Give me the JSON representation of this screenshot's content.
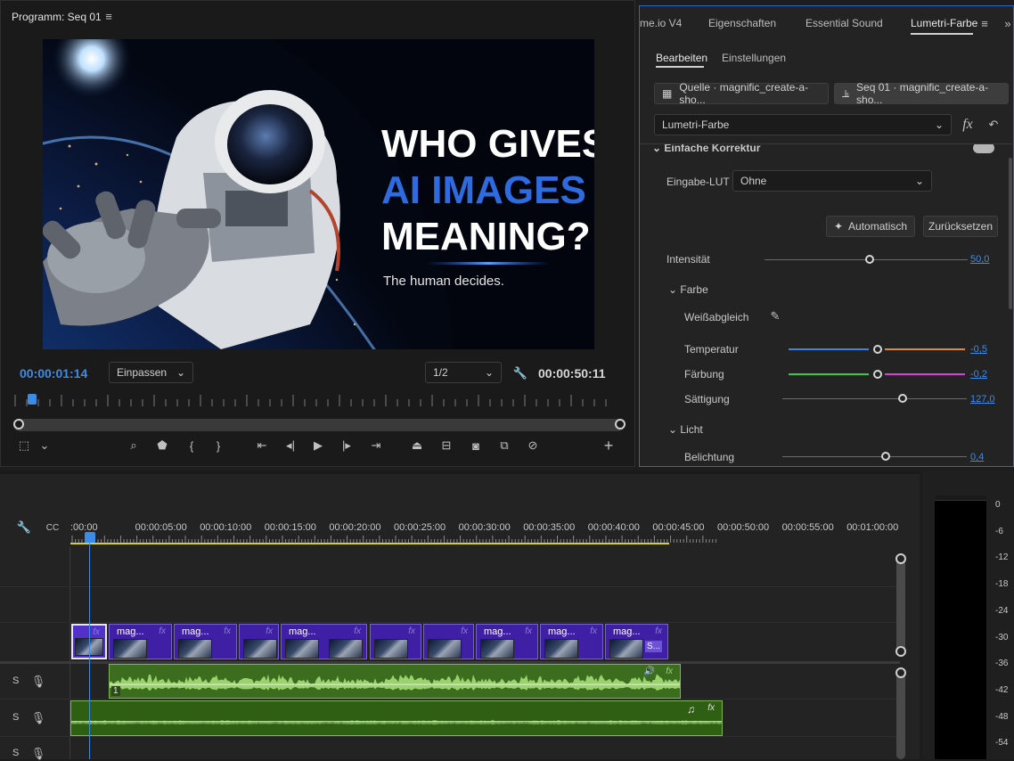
{
  "program": {
    "title": "Programm: Seq 01",
    "menu_icon": "hamburger-icon",
    "current_time": "00:00:01:14",
    "fit": "Einpassen",
    "resolution": "1/2",
    "duration": "00:00:50:11",
    "playhead_fraction": 0.03
  },
  "video_frame": {
    "headline_line1": "WHO GIVES",
    "headline_line2": "AI IMAGES",
    "headline_line3": "MEANING?",
    "subline": "The human decides.",
    "accent_color": "#2f6be0"
  },
  "lumetri": {
    "tabs": [
      "me.io V4",
      "Eigenschaften",
      "Essential Sound",
      "Lumetri-Farbe"
    ],
    "active_tab": "Lumetri-Farbe",
    "subtabs": [
      "Bearbeiten",
      "Einstellungen"
    ],
    "source_clip": "Quelle · magnific_create-a-sho...",
    "seq_clip": "Seq 01 · magnific_create-a-sho...",
    "effect": "Lumetri-Farbe",
    "section_basic": "Einfache Korrektur",
    "lut_label": "Eingabe-LUT",
    "lut_value": "Ohne",
    "auto_button": "Automatisch",
    "reset_button": "Zurücksetzen",
    "intensity_label": "Intensität",
    "intensity_value": "50,0",
    "color_section": "Farbe",
    "wb_label": "Weißabgleich",
    "temp_label": "Temperatur",
    "temp_value": "-0,5",
    "tint_label": "Färbung",
    "tint_value": "-0,2",
    "sat_label": "Sättigung",
    "sat_value": "127,0",
    "light_section": "Licht",
    "exposure_label": "Belichtung",
    "exposure_value": "0,4"
  },
  "timeline": {
    "ruler": ":00:00|00:00:05:00|00:00:10:00|00:00:15:00|00:00:20:00|00:00:25:00|00:00:30:00|00:00:35:00|00:00:40:00|00:00:45:00|00:00:50:00|00:00:55:00|00:01:00:00|00:",
    "clip_name": "mag...",
    "clip_name_short": "S...",
    "fx": "fx",
    "track_s": "S",
    "clip_number": "1"
  },
  "meter": {
    "scale": [
      "0",
      "-6",
      "-12",
      "-18",
      "-24",
      "-30",
      "-36",
      "-42",
      "-48",
      "-54"
    ]
  }
}
